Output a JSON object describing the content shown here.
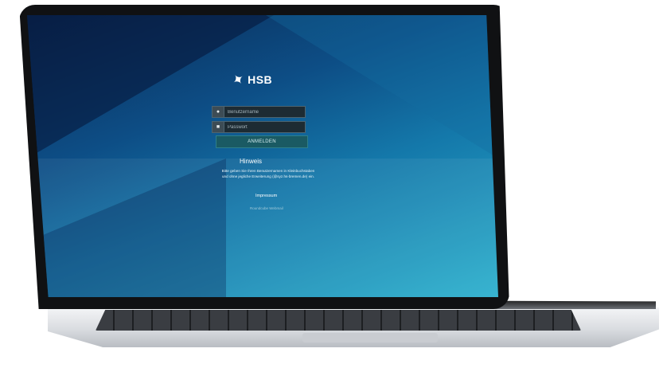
{
  "app": {
    "logo_text": "HSB",
    "logo_icon": "satellite-icon"
  },
  "login": {
    "username_placeholder": "Benutzername",
    "password_placeholder": "Passwort",
    "submit_label": "ANMELDEN",
    "username_icon": "user-icon",
    "password_icon": "lock-icon"
  },
  "notice": {
    "title": "Hinweis",
    "text": "Bitte geben Sie Ihren Benutzernamen in Kleinbuchstaben und ohne jegliche Erweiterung (@syz.hs-bremen.de) ein."
  },
  "footer": {
    "impressum": "Impressum",
    "webmail": "Roundcube Webmail"
  },
  "colors": {
    "screen_dark": "#0b2a55",
    "screen_light": "#2cb0cd",
    "button_bg": "#1a5a63"
  }
}
